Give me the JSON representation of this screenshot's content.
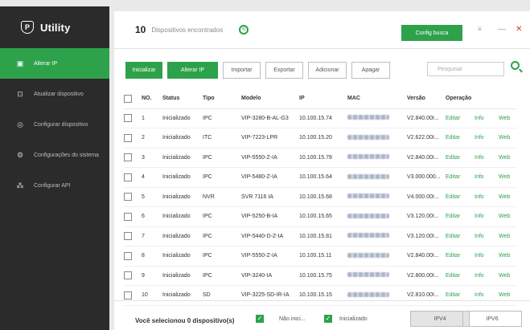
{
  "app": {
    "title": "Utility"
  },
  "sidebar": {
    "items": [
      {
        "label": "Alterar IP",
        "icon": "screen-icon",
        "active": true
      },
      {
        "label": "Atualizar dispositivo",
        "icon": "upload-icon",
        "active": false
      },
      {
        "label": "Configurar dispositivo",
        "icon": "gear-icon",
        "active": false
      },
      {
        "label": "Configurações do sistema",
        "icon": "settings-icon",
        "active": false
      },
      {
        "label": "Configurar API",
        "icon": "api-icon",
        "active": false
      }
    ]
  },
  "header": {
    "count": "10",
    "count_label": "Dispositivos encontrados",
    "config_button": "Config busca"
  },
  "toolbar": {
    "buttons": [
      "Inicializar",
      "Alterar IP",
      "Importar",
      "Exportar",
      "Adicionar",
      "Apagar"
    ],
    "search_placeholder": "Pesquisar"
  },
  "table": {
    "headers": [
      "NO.",
      "Status",
      "Tipo",
      "Modelo",
      "IP",
      "MAC",
      "Versão",
      "Operação"
    ],
    "rows": [
      {
        "no": "1",
        "status": "Inicializado",
        "tipo": "IPC",
        "modelo": "VIP-3280-B-AL-G3",
        "ip": "10.100.15.74",
        "versao": "V2.840.00I...",
        "edit": "Editar",
        "info": "Info",
        "web": "Web"
      },
      {
        "no": "2",
        "status": "Inicializado",
        "tipo": "ITC",
        "modelo": "VIP-7223-LPR",
        "ip": "10.100.15.20",
        "versao": "V2.622.00I...",
        "edit": "Editar",
        "info": "Info",
        "web": "Web"
      },
      {
        "no": "3",
        "status": "Inicializado",
        "tipo": "IPC",
        "modelo": "VIP-5550-Z-IA",
        "ip": "10.100.15.78",
        "versao": "V2.840.00I...",
        "edit": "Editar",
        "info": "Info",
        "web": "Web"
      },
      {
        "no": "4",
        "status": "Inicializado",
        "tipo": "IPC",
        "modelo": "VIP-5480-Z-IA",
        "ip": "10.100.15.64",
        "versao": "V3.000.000...",
        "edit": "Editar",
        "info": "Info",
        "web": "Web"
      },
      {
        "no": "5",
        "status": "Inicializado",
        "tipo": "NVR",
        "modelo": "SVR 7116 IA",
        "ip": "10.100.15.68",
        "versao": "V4.000.00I...",
        "edit": "Editar",
        "info": "Info",
        "web": "Web"
      },
      {
        "no": "6",
        "status": "Inicializado",
        "tipo": "IPC",
        "modelo": "VIP-5250-B-IA",
        "ip": "10.100.15.65",
        "versao": "V3.120.00I...",
        "edit": "Editar",
        "info": "Info",
        "web": "Web"
      },
      {
        "no": "7",
        "status": "Inicializado",
        "tipo": "IPC",
        "modelo": "VIP-5440-D-Z-IA",
        "ip": "10.100.15.81",
        "versao": "V3.120.00I...",
        "edit": "Editar",
        "info": "Info",
        "web": "Web"
      },
      {
        "no": "8",
        "status": "Inicializado",
        "tipo": "IPC",
        "modelo": "VIP-5550-Z-IA",
        "ip": "10.100.15.11",
        "versao": "V2.840.00I...",
        "edit": "Editar",
        "info": "Info",
        "web": "Web"
      },
      {
        "no": "9",
        "status": "Inicializado",
        "tipo": "IPC",
        "modelo": "VIP-3240-IA",
        "ip": "10.100.15.75",
        "versao": "V2.800.00I...",
        "edit": "Editar",
        "info": "Info",
        "web": "Web"
      },
      {
        "no": "10",
        "status": "Inicializado",
        "tipo": "SD",
        "modelo": "VIP-3225-SD-IR-IA",
        "ip": "10.100.15.15",
        "versao": "V2.810.00I...",
        "edit": "Editar",
        "info": "Info",
        "web": "Web"
      }
    ]
  },
  "footer": {
    "selected_text": "Você selecionou 0 dispositivo(s)",
    "legend_uninit": "Não inici...",
    "legend_init": "Inicializado",
    "ipv4": "IPV4",
    "ipv6": "IPV6"
  },
  "colors": {
    "accent": "#2da24a",
    "sidebar_bg": "#2b2b2b"
  }
}
